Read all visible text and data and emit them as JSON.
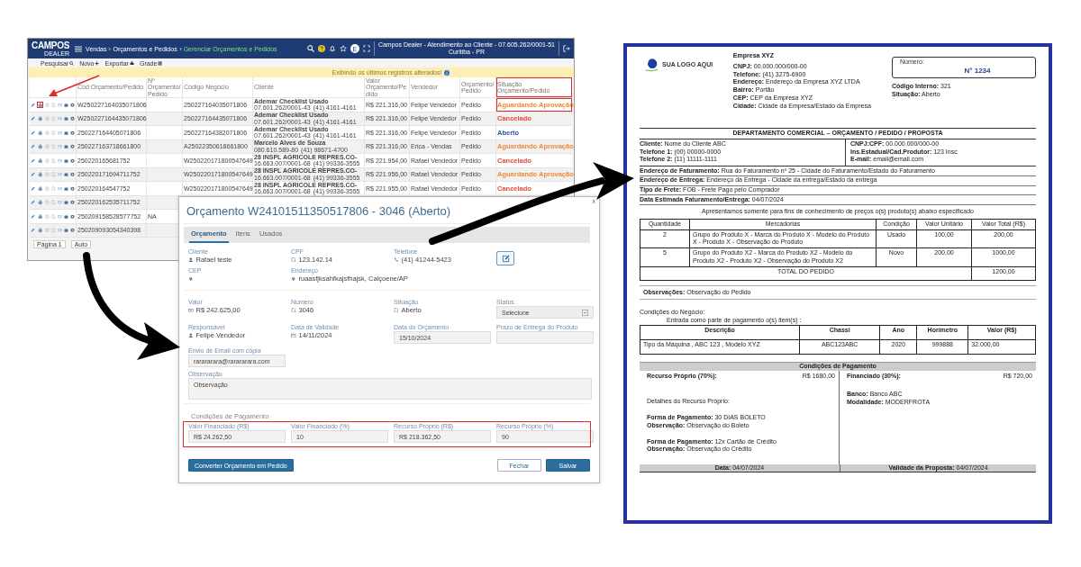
{
  "list_window": {
    "topbar": {
      "logo": "CAMPOS",
      "logo_sub": "DEALER",
      "breadcrumb": [
        {
          "label": "Vendas",
          "current": false
        },
        {
          "label": "Orçamentos e Pedidos",
          "current": false
        },
        {
          "label": "Gerenciar Orçamentos e Pedidos",
          "current": true
        }
      ],
      "avatar": "E",
      "company": "Campos Dealer - Atendimento ao Cliente - 07.605.262/0001-51",
      "city": "Curitiba - PR"
    },
    "toolbar": [
      "Pesquisar",
      "Novo",
      "Exportar",
      "Grade"
    ],
    "banner": "Exibindo os últimos registros alterados!",
    "columns": [
      {
        "label": "Cód Orçamento/Pedido",
        "highlighted": false
      },
      {
        "label": "Nº Orçamento/Pedido",
        "highlighted": false
      },
      {
        "label": "Código Negócio",
        "highlighted": false
      },
      {
        "label": "Cliente",
        "highlighted": false
      },
      {
        "label": "Valor Orçamento/Pedido",
        "highlighted": false
      },
      {
        "label": "Vendedor",
        "highlighted": false
      },
      {
        "label": "Orçamento/Pedido",
        "highlighted": false
      },
      {
        "label": "Situação Orçamento/Pedido",
        "highlighted": true
      }
    ],
    "rows": [
      {
        "highlighted": true,
        "code": "W250227164035071806",
        "business": "250227164035071806",
        "client": {
          "name": "Ademar Checklist Usado",
          "doc": "07.601.262/0001-43",
          "phone": "(41) 4161-4161"
        },
        "value": "R$ 221.316,00",
        "seller": "Felipe Vendedor",
        "type": "Pedido",
        "status": {
          "label": "Aguardando Aprovação",
          "color": "#f0883a"
        }
      },
      {
        "highlighted": false,
        "code": "W250227164435071806",
        "business": "250227164435071806",
        "client": {
          "name": "Ademar Checklist Usado",
          "doc": "07.601.262/0001-43",
          "phone": "(41) 4161-4161"
        },
        "value": "R$ 221.316,00",
        "seller": "Felipe Vendedor",
        "type": "Pedido",
        "status": {
          "label": "Cancelado",
          "color": "#e5483a"
        }
      },
      {
        "highlighted": false,
        "code": "250227164405071806",
        "business": "250227164382071806",
        "client": {
          "name": "Ademar Checklist Usado",
          "doc": "07.601.262/0001-43",
          "phone": "(41) 4161-4161"
        },
        "value": "R$ 221.316,00",
        "seller": "Felipe Vendedor",
        "type": "Pedido",
        "status": {
          "label": "Aberto",
          "color": "#2a55a8"
        }
      },
      {
        "highlighted": false,
        "code": "250227163718661800",
        "business": "A25022350618661800",
        "client": {
          "name": "Marcelo Alves de Souza",
          "doc": "080.610.589-80",
          "phone": "(41) 98671-4700"
        },
        "value": "R$ 221.316,00",
        "seller": "Erica - Vendas",
        "type": "Pedido",
        "status": {
          "label": "Aguardando Aprovação",
          "color": "#f0883a"
        }
      },
      {
        "highlighted": false,
        "code": "250220165681752",
        "business": "W250220171800547649",
        "client": {
          "name": "28 INSPL AGRICOLE REPRES.CO-",
          "doc": "16.663.007/0001-68",
          "phone": "(41) 99336-3555"
        },
        "value": "R$ 221.954,00",
        "seller": "Rafael Vendedor",
        "type": "Pedido",
        "status": {
          "label": "Cancelado",
          "color": "#e5483a"
        }
      },
      {
        "highlighted": false,
        "code": "250220171694711752",
        "business": "W250220171800547649",
        "client": {
          "name": "28 INSPL AGRICOLE REPRES.CO-",
          "doc": "16.663.007/0001-68",
          "phone": "(41) 99336-3555"
        },
        "value": "R$ 221.956,00",
        "seller": "Rafael Vendedor",
        "type": "Pedido",
        "status": {
          "label": "Aguardando Aprovação",
          "color": "#f0883a"
        }
      },
      {
        "highlighted": false,
        "code": "250220164547752",
        "business": "W250220171800547649",
        "client": {
          "name": "28 INSPL AGRICOLE REPRES.CO-",
          "doc": "16.663.007/0001-68",
          "phone": "(41) 99336-3555"
        },
        "value": "R$ 221.955,00",
        "seller": "Rafael Vendedor",
        "type": "Pedido",
        "status": {
          "label": "Cancelado",
          "color": "#e5483a"
        }
      },
      {
        "highlighted": false,
        "code": "250220162535711752"
      },
      {
        "highlighted": false,
        "code": "250209158528577752",
        "number": "NA"
      },
      {
        "highlighted": false,
        "code": "250209093054340398"
      }
    ],
    "pagination": {
      "page": "Página 1",
      "size": "Auto"
    }
  },
  "quote_dialog": {
    "title": "Orçamento W24101511350517806 - 3046 (Aberto)",
    "close": "x",
    "tabs": [
      {
        "label": "Orçamento",
        "selected": true
      },
      {
        "label": "Itens",
        "selected": false
      },
      {
        "label": "Usados",
        "selected": false
      }
    ],
    "header_fields": [
      {
        "label": "Cliente",
        "value": "Rafael teste"
      },
      {
        "label": "CPF",
        "value": "123.142.14"
      },
      {
        "label": "Telefone",
        "value": "(41) 41244-5423"
      },
      {
        "label": "CEP"
      },
      {
        "label": "Endereço",
        "value": "ruaasfjksahfkajsfhajsk, Calçoene/AP"
      }
    ],
    "fields": [
      {
        "kind": "display",
        "label": "Valor",
        "value": "R$ 242.625,00"
      },
      {
        "kind": "display",
        "label": "Número",
        "value": "3046"
      },
      {
        "kind": "display",
        "label": "Situação",
        "value": "Aberto"
      },
      {
        "kind": "select",
        "label": "Status",
        "value": "Selecione"
      },
      {
        "kind": "display",
        "label": "Responsável",
        "value": "Felipe Vendedor"
      },
      {
        "kind": "display",
        "label": "Data de Validade",
        "value": "14/11/2024"
      },
      {
        "kind": "input",
        "label": "Data do Orçamento",
        "value": "15/10/2024"
      },
      {
        "kind": "input",
        "label": "Prazo de Entrega do Produto"
      }
    ],
    "email": {
      "label": "Envio de Email com cópia",
      "value": "rarararara@rarararara.com"
    },
    "notes": {
      "label": "Observação",
      "value": "Observação"
    },
    "payment": {
      "title": "Condições de Pagamento",
      "highlighted": true,
      "fields": [
        {
          "label": "Valor Financiado (R$)",
          "value": "R$ 24.262,50"
        },
        {
          "label": "Valor Financiado (%)",
          "value": "10"
        },
        {
          "label": "Recurso Próprio (R$)",
          "value": "R$ 218.362,50"
        },
        {
          "label": "Recurso Próprio (%)",
          "value": "90"
        }
      ]
    },
    "buttons": [
      {
        "label": "Converter Orçamento em Pedido",
        "kind": "primary"
      },
      {
        "label": "Fechar",
        "kind": "secondary"
      },
      {
        "label": "Salvar",
        "kind": "primary"
      }
    ]
  },
  "document": {
    "logo": "SUA LOGO AQUI",
    "company": {
      "name": "Empresa XYZ",
      "lines": [
        {
          "label": "CNPJ:",
          "value": "00.000.000/000-00"
        },
        {
          "label": "Telefone:",
          "value": "(41) 3275-6900"
        },
        {
          "label": "Endereço:",
          "value": "Endereço da Empresa XYZ LTDA"
        },
        {
          "label": "Bairro:",
          "value": "Portão"
        },
        {
          "label": "CEP:",
          "value": "CEP da Empresa XYZ"
        },
        {
          "label": "Cidade:",
          "value": "Cidade da Empresa/Estado da Empresa"
        }
      ]
    },
    "number_box": {
      "label": "Número:",
      "value": "N° 1234"
    },
    "meta": [
      {
        "label": "Código Interno:",
        "value": "321"
      },
      {
        "label": "Situação:",
        "value": "Aberto"
      }
    ],
    "title": "DEPARTAMENTO COMERCIAL – ORÇAMENTO / PEDIDO / PROPOSTA",
    "client_left": [
      {
        "label": "Cliente:",
        "value": "Nome do Cliente ABC"
      },
      {
        "label": "Telefone 1:",
        "value": "(00) 00000-0000"
      },
      {
        "label": "Telefone 2:",
        "value": "(11) 11111-1111"
      }
    ],
    "client_right": [
      {
        "label": "CNPJ:CPF:",
        "value": "00.000.000/000-00"
      },
      {
        "label": "Ins.Estadual/Cad.Produtor:",
        "value": "123 Insc"
      },
      {
        "label": "E-mail:",
        "value": "email@email.com"
      }
    ],
    "address_rows": [
      {
        "label": "Endereço de Faturamento:",
        "value": "Rua do Faturamento nº 25 - Cidade do Faturamento/Estado do Faturamento"
      },
      {
        "label": "Endereço de Entrega:",
        "value": "Endereço da Entrega - Cidade da entrega/Estado da entrega"
      },
      {
        "label": "Tipo de Frete:",
        "value": "FOB - Frete Pago pelo Comprador"
      },
      {
        "label": "Data Estimada Faturamento/Entrega:",
        "value": "04/07/2024"
      }
    ],
    "note": "Apresentamos somente para fins de conhecimento de preços o(s) produto(s) abaixo especificado",
    "items_table": {
      "columns": [
        "Quantidade",
        "Mercadorias",
        "Condição",
        "Valor Unitário",
        "Valor Total (R$)"
      ],
      "rows": [
        [
          "2",
          "Grupo do Produto X - Marca do Produto X - Modelo do Produto X - Produto X - Observação do Produto",
          "Usado",
          "100,00",
          "200,00"
        ],
        [
          "5",
          "Grupo do Produto X2 - Marca do Produto X2 - Modelo do Produto X2 - Produto X2 - Observação do Produto X2",
          "Novo",
          "200,00",
          "1000,00"
        ]
      ],
      "total_label": "TOTAL DO PEDIDO",
      "total": "1200,00"
    },
    "observations": {
      "label": "Observações:",
      "value": "Observação do Pedido"
    },
    "business_title": "Condições do Negócio:",
    "trade_in_note": "Entrada como parte de pagamento o(s) item(s) :",
    "trade_table": {
      "columns": [
        "Descrição",
        "Chassi",
        "Ano",
        "Horímetro",
        "Valor (R$)"
      ],
      "rows": [
        [
          "Tipo da Máquina , ABC 123 , Modelo XYZ",
          "ABC123ABC",
          "2020",
          "999888",
          "32.000,00"
        ]
      ]
    },
    "payment": {
      "title": "Condições de Pagamento",
      "left": {
        "label": "Recurso Próprio (70%):",
        "amount": "R$ 1680,00",
        "details": "Detalhes do Recurso Próprio:",
        "groups": [
          [
            {
              "label": "Forma de Pagamento:",
              "value": "30 DIAS BOLETO"
            },
            {
              "label": "Observação:",
              "value": "Observação do Boleto"
            }
          ],
          [
            {
              "label": "Forma de Pagamento:",
              "value": "12x Cartão de Crédito"
            },
            {
              "label": "Observação:",
              "value": "Observação do Crédito"
            }
          ]
        ]
      },
      "right": {
        "label": "Financiado (30%):",
        "amount": "R$ 720,00",
        "lines": [
          {
            "label": "Banco:",
            "value": "Banco ABC"
          },
          {
            "label": "Modalidade:",
            "value": "MODERFROTA"
          }
        ]
      }
    },
    "footer": [
      {
        "label": "Data:",
        "value": "04/07/2024"
      },
      {
        "label": "Validade da Proposta:",
        "value": "04/07/2024"
      }
    ]
  }
}
